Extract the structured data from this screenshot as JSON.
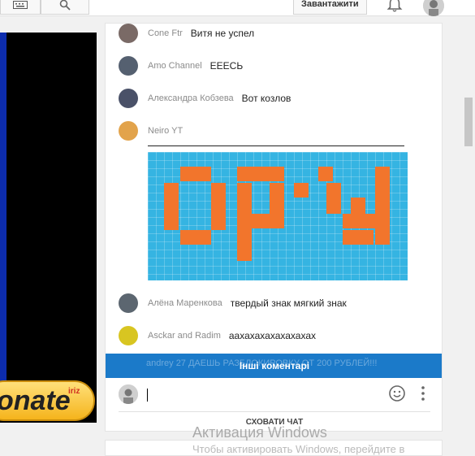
{
  "header": {
    "upload_label": "Завантажити"
  },
  "donate": {
    "label": "onate",
    "badge": "iriz"
  },
  "chat": {
    "messages": [
      {
        "author": "Cone Ftr",
        "text": "Витя не успел",
        "avatar_color": "#7a6a66"
      },
      {
        "author": "Amo Channel",
        "text": "ЕЕЕСЬ",
        "avatar_color": "#556070"
      },
      {
        "author": "Александра Кобзева",
        "text": "Вот козлов",
        "avatar_color": "#4a5168"
      },
      {
        "author": "Neiro YT",
        "text": "___________________________________________",
        "avatar_color": "#e2a34b"
      },
      {
        "author": "Алёна Маренкова",
        "text": "твердый знак мягкий знак",
        "avatar_color": "#5c6670"
      },
      {
        "author": "Asckar and Radim",
        "text": "аахахахахахахахах",
        "avatar_color": "#d8c521"
      }
    ],
    "ghost_text": "andrey 27   ДАЕШЬ РАЗБЛОКИРОВКУ ОТ 200 РУБЛЕЙ!!!",
    "more_comments_label": "Інші коментарі",
    "input_placeholder": "",
    "hide_chat_label": "СХОВАТИ ЧАТ"
  },
  "watermark": {
    "line1": "Активация Windows",
    "line2": "Чтобы активировать Windows, перейдите в"
  },
  "colors": {
    "accent": "#1b7ac9",
    "pixel_bg": "#35b4e2",
    "pixel_fg": "#f2752c"
  }
}
